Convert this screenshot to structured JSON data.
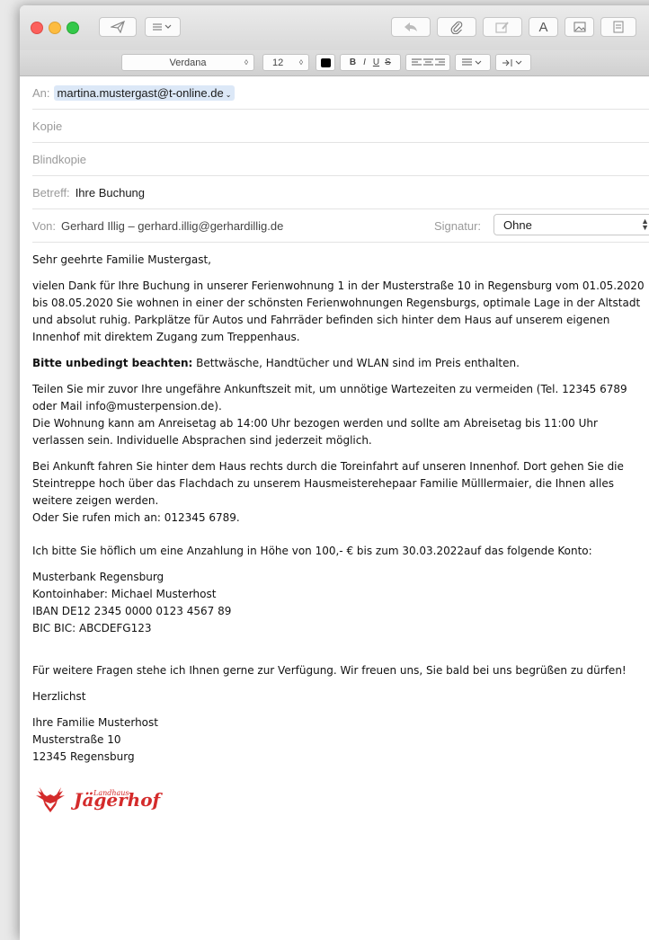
{
  "format": {
    "font": "Verdana",
    "size": "12",
    "text_color": "#000000",
    "buttons": [
      "B",
      "I",
      "U",
      "S"
    ]
  },
  "header": {
    "to_label": "An:",
    "to_value": "martina.mustergast@t-online.de",
    "cc_label": "Kopie",
    "bcc_label": "Blindkopie",
    "subject_label": "Betreff:",
    "subject_value": "Ihre Buchung",
    "from_label": "Von:",
    "from_value": "Gerhard Illig – gerhard.illig@gerhardillig.de",
    "signature_label": "Signatur:",
    "signature_value": "Ohne"
  },
  "body": {
    "greeting": "Sehr geehrte Familie Mustergast,",
    "p1": "vielen Dank für Ihre Buchung in unserer Ferienwohnung 1 in der Musterstraße 10 in Regensburg vom 01.05.2020 bis 08.05.2020 Sie wohnen in einer der schönsten Ferienwohnungen Regensburgs, optimale Lage in der Altstadt und absolut ruhig. Parkplätze für Autos und Fahrräder befinden sich hinter dem Haus auf unserem eigenen Innenhof mit direktem Zugang zum Treppenhaus.",
    "note_bold": "Bitte unbedingt beachten:",
    "note_rest": " Bettwäsche, Handtücher und WLAN sind im Preis enthalten.",
    "p3": "Teilen Sie mir zuvor Ihre ungefähre Ankunftszeit mit, um unnötige Wartezeiten zu vermeiden (Tel. 12345 6789 oder Mail info@musterpension.de).\nDie Wohnung kann am Anreisetag ab 14:00 Uhr bezogen werden und sollte am Abreisetag bis 11:00 Uhr verlassen sein. Individuelle Absprachen sind jederzeit möglich.",
    "p4": "Bei Ankunft fahren Sie hinter dem Haus rechts durch die Toreinfahrt auf unseren Innenhof. Dort gehen Sie die Steintreppe hoch über das Flachdach zu unserem Hausmeisterehepaar Familie Mülllermaier, die Ihnen alles weitere zeigen werden.\nOder Sie rufen mich an: 012345 6789.",
    "p5": "Ich bitte Sie höflich um eine Anzahlung in Höhe von 100,- € bis zum 30.03.2022auf das folgende Konto:",
    "bank": "Musterbank Regensburg\nKontoinhaber: Michael Musterhost\nIBAN DE12 2345 0000 0123 4567 89\nBIC BIC: ABCDEFG123",
    "p6": "Für weitere Fragen stehe ich Ihnen gerne zur Verfügung. Wir freuen uns, Sie bald bei uns begrüßen zu dürfen!",
    "closing": "Herzlichst",
    "signature": "Ihre Familie Musterhost\nMusterstraße 10\n12345 Regensburg"
  },
  "logo": {
    "small": "Landhaus",
    "big": "Jägerhof",
    "color": "#d42b2b"
  }
}
